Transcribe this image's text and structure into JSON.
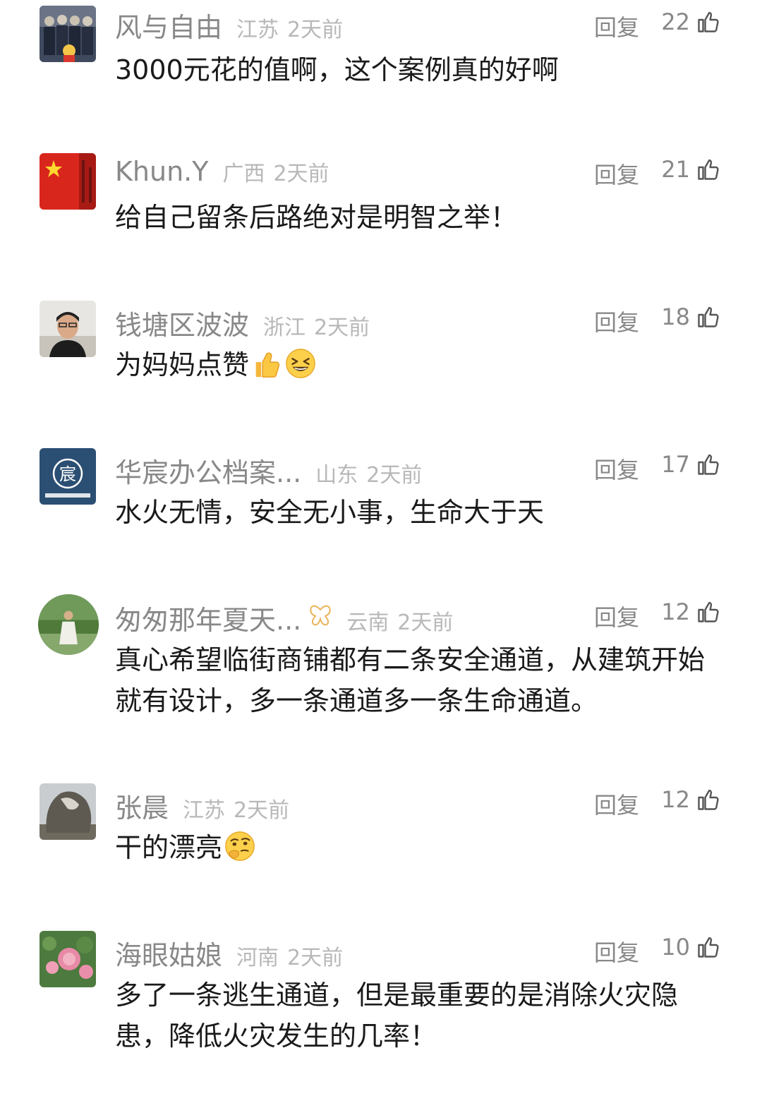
{
  "reply_label": "回复",
  "comments": [
    {
      "username": "风与自由",
      "location": "江苏",
      "time": "2天前",
      "likes": "22",
      "text": "3000元花的值啊，这个案例真的好啊"
    },
    {
      "username": "Khun.Y",
      "location": "广西",
      "time": "2天前",
      "likes": "21",
      "text": "给自己留条后路绝对是明智之举！"
    },
    {
      "username": "钱塘区波波",
      "location": "浙江",
      "time": "2天前",
      "likes": "18",
      "text": "为妈妈点赞",
      "emojis": [
        "thumbs-up-emoji",
        "grinning-squint-emoji"
      ]
    },
    {
      "username": "华宸办公档案...",
      "location": "山东",
      "time": "2天前",
      "likes": "17",
      "text": "水火无情，安全无小事，生命大于天",
      "avatar_text": "宸"
    },
    {
      "username": "匆匆那年夏天...",
      "location": "云南",
      "time": "2天前",
      "likes": "12",
      "text": "真心希望临街商铺都有二条安全通道，从建筑开始就有设计，多一条通道多一条生命通道。",
      "badge_icon": "butterfly-icon"
    },
    {
      "username": "张晨",
      "location": "江苏",
      "time": "2天前",
      "likes": "12",
      "text": "干的漂亮",
      "emojis": [
        "thinking-face-emoji"
      ]
    },
    {
      "username": "海眼姑娘",
      "location": "河南",
      "time": "2天前",
      "likes": "10",
      "text": "多了一条逃生通道，但是最重要的是消除火灾隐患，降低火灾发生的几率！"
    }
  ],
  "colors": {
    "username": "#888888",
    "meta": "#b8b8b8",
    "text": "#1a1a1a"
  }
}
